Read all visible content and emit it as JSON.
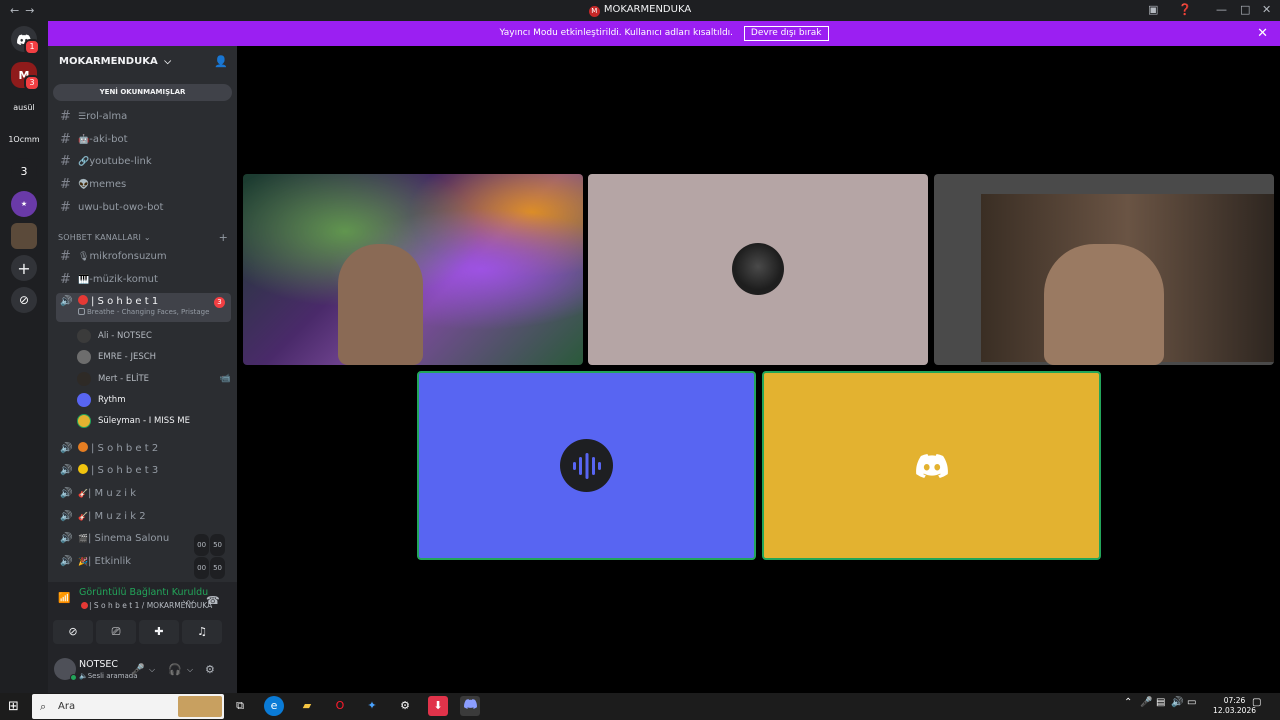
{
  "window": {
    "title": "MOKARMENDUKA",
    "app_badge": "M",
    "nav_back": "←",
    "nav_forward": "→",
    "inbox_icon": "inbox-icon",
    "help_icon": "help-icon",
    "controls": [
      "—",
      "□",
      "✕"
    ]
  },
  "banner": {
    "text": "Yayıncı Modu etkinleştirildi. Kullanıcı adları kısaltıldı.",
    "button_label": "Devre dışı bırak",
    "close": "✕"
  },
  "servers": {
    "dm_badge": "1",
    "server1_badge": "3",
    "labels": [
      "ausül",
      "1Ocmm",
      "3"
    ]
  },
  "guild": {
    "name": "MOKARMENDUKA",
    "chevron": "⌵",
    "unread_label": "YENİ OKUNMAMIŞLAR"
  },
  "text_channels": [
    {
      "icon": "☰",
      "name": "rol-alma"
    },
    {
      "icon": "🤖",
      "name": "-aki-bot"
    },
    {
      "icon": "🔗",
      "name": "youtube-link"
    },
    {
      "icon": "👽",
      "name": "memes"
    },
    {
      "icon": "",
      "name": "uwu-but-owo-bot"
    }
  ],
  "category": {
    "label": "SOHBET KANALLARI",
    "chevron": "⌄",
    "add": "+"
  },
  "category_channels": [
    {
      "icon": "🎙",
      "name": "mikrofonsuzum"
    },
    {
      "icon": "🎹",
      "name": "-müzik-komut"
    }
  ],
  "active_voice": {
    "name": "| S o h b e t 1",
    "activity": "Breathe - Changing Faces, Pristage",
    "mention_badge": "3"
  },
  "voice_members": [
    {
      "name": "Ali - NOTSEC",
      "camera": ""
    },
    {
      "name": "EMRE - JESCH",
      "camera": ""
    },
    {
      "name": "Mert - ELİTE",
      "camera": "📹"
    },
    {
      "name": "Rythm",
      "camera": ""
    },
    {
      "name": "Süleyman - I MISS ME",
      "camera": ""
    }
  ],
  "voice_channels": [
    {
      "dot_color": "#e67e22",
      "name": "| S o h b e t 2",
      "counts": []
    },
    {
      "dot_color": "#f1c40f",
      "name": "| S o h b e t 3",
      "counts": []
    },
    {
      "dot_color": "",
      "icon": "🎸",
      "name": "| M u z i k",
      "counts": []
    },
    {
      "dot_color": "",
      "icon": "🎸",
      "name": "| M u z i k 2",
      "counts": []
    },
    {
      "dot_color": "",
      "icon": "🎬",
      "name": "| Sinema Salonu",
      "counts": [
        "00",
        "50"
      ]
    },
    {
      "dot_color": "",
      "icon": "🎉",
      "name": "| Etkinlik",
      "counts": [
        "00",
        "50"
      ]
    }
  ],
  "voice_panel": {
    "status": "Görüntülü Bağlantı Kuruldu",
    "channel": "| S o h b e t 1 / MOKARMENDUKA"
  },
  "user": {
    "name": "NOTSEC",
    "status": "Sesli aramada"
  },
  "taskbar": {
    "search_placeholder": "Ara",
    "time": "07:26",
    "date": "12.03.2026"
  },
  "colors": {
    "banner": "#9b1ff2",
    "rythm_tile": "#5865f2",
    "discord_tile": "#e3b230",
    "avatar_tile": "#b5a5a5",
    "connected": "#23a55a"
  }
}
